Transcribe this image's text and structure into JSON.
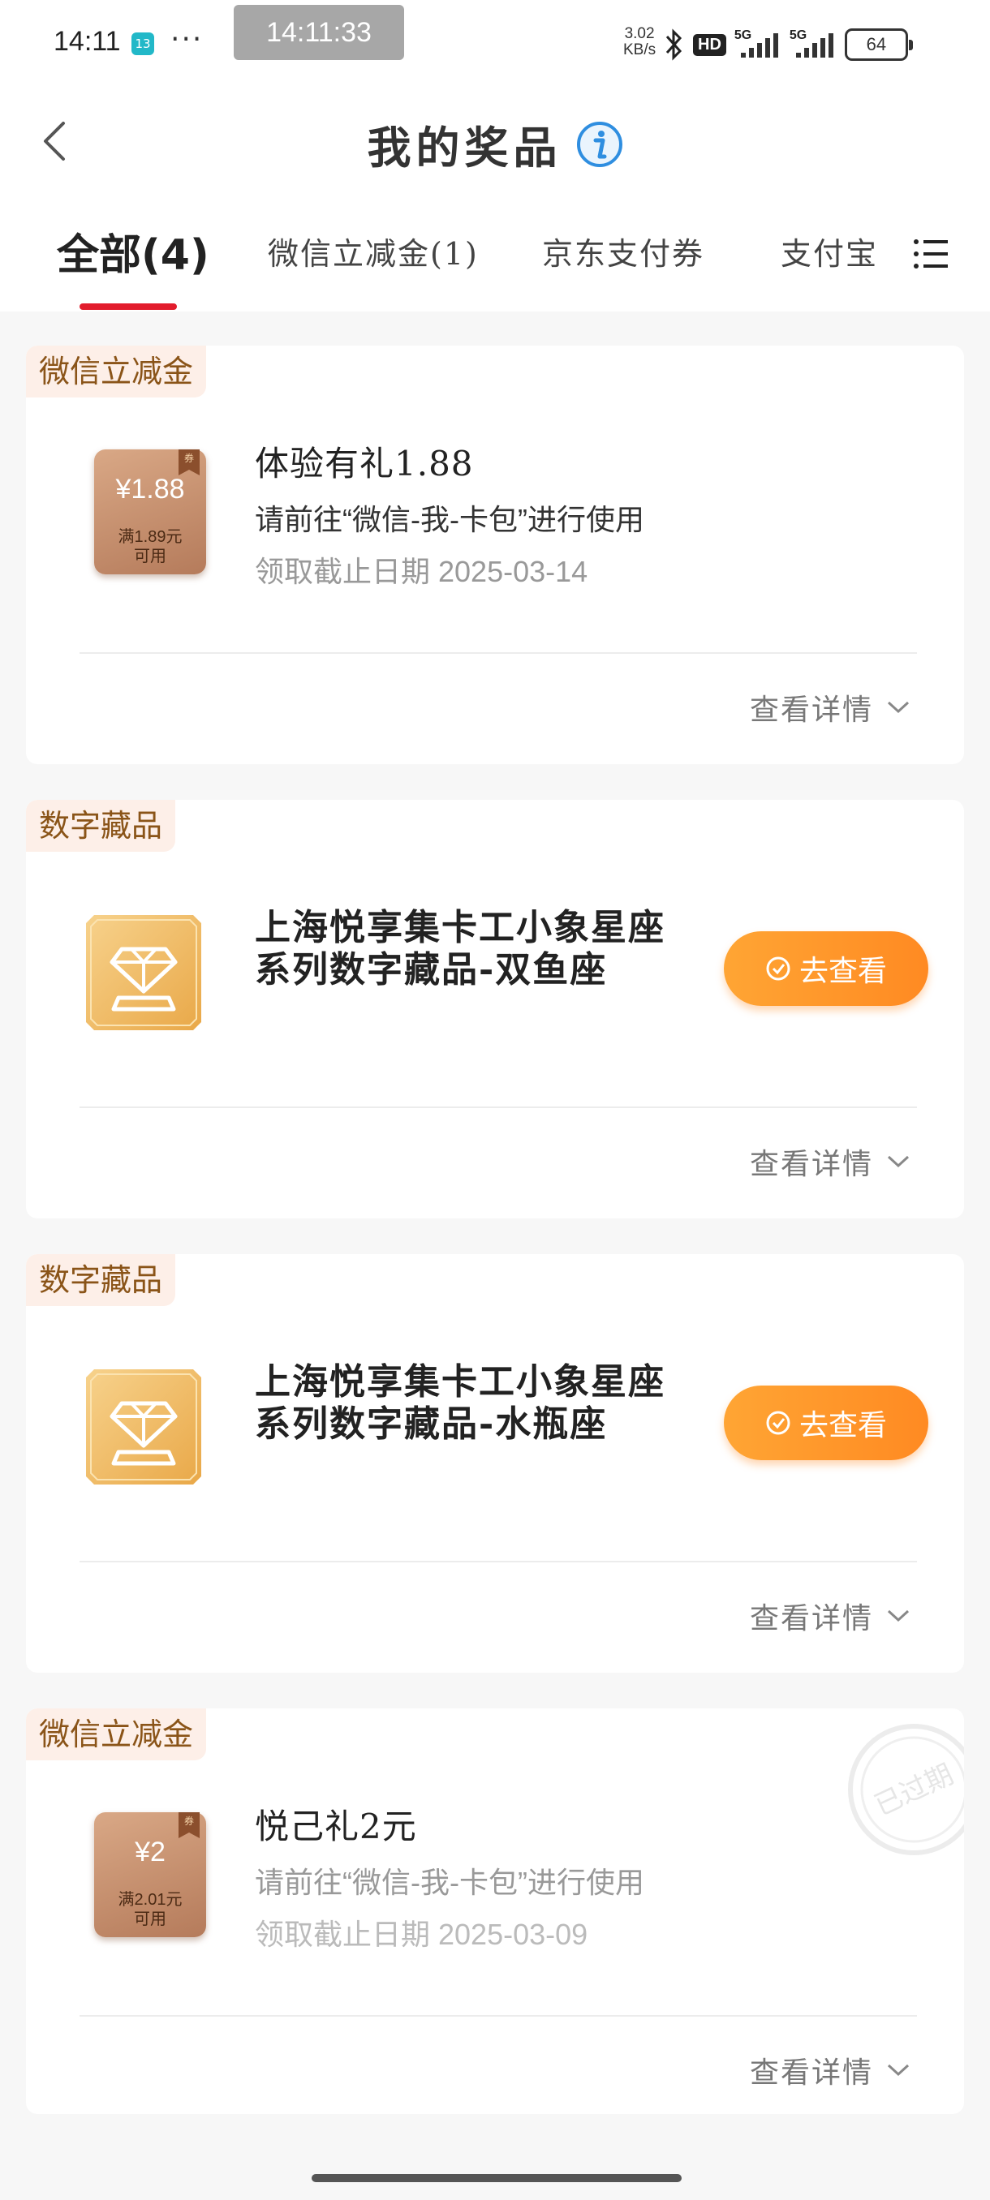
{
  "status_bar": {
    "time": "14:11",
    "app_badge": "13",
    "more": "···",
    "clock": "14:11:33",
    "net_speed_value": "3.02",
    "net_speed_unit": "KB/s",
    "hd": "HD",
    "sim1": "5G",
    "sim2": "5G",
    "battery": "64"
  },
  "header": {
    "title": "我的奖品"
  },
  "tabs": [
    {
      "label": "全部(4)",
      "active": true
    },
    {
      "label": "微信立减金(1)",
      "active": false
    },
    {
      "label": "京东支付券",
      "active": false
    },
    {
      "label": "支付宝",
      "active": false
    }
  ],
  "cards": [
    {
      "tag": "微信立减金",
      "coupon_amount": "¥1.88",
      "coupon_cond_1": "满1.89元",
      "coupon_cond_2": "可用",
      "title": "体验有礼1.88",
      "desc": "请前往“微信-我-卡包”进行使用",
      "date": "领取截止日期 2025-03-14",
      "detail": "查看详情"
    },
    {
      "tag": "数字藏品",
      "title_line1": "上海悦享集卡工小象星座",
      "title_line2": "系列数字藏品-双鱼座",
      "button": "去查看",
      "detail": "查看详情"
    },
    {
      "tag": "数字藏品",
      "title_line1": "上海悦享集卡工小象星座",
      "title_line2": "系列数字藏品-水瓶座",
      "button": "去查看",
      "detail": "查看详情"
    },
    {
      "tag": "微信立减金",
      "coupon_amount": "¥2",
      "coupon_cond_1": "满2.01元",
      "coupon_cond_2": "可用",
      "title": "悦己礼2元",
      "desc": "请前往“微信-我-卡包”进行使用",
      "date": "领取截止日期 2025-03-09",
      "detail": "查看详情",
      "stamp": "已过期"
    }
  ],
  "icons": {
    "back": "chevron-left-icon",
    "info": "info-icon",
    "menu": "list-menu-icon",
    "collectible": "diamond-icon",
    "check": "check-circle-icon",
    "expand": "chevron-down-icon"
  },
  "colors": {
    "accent_red": "#e21c2c",
    "button_orange": "#ff9a2e",
    "tag_text": "#8a5418",
    "tag_bg": "#fdefe8",
    "info_blue": "#2f8ee0"
  }
}
